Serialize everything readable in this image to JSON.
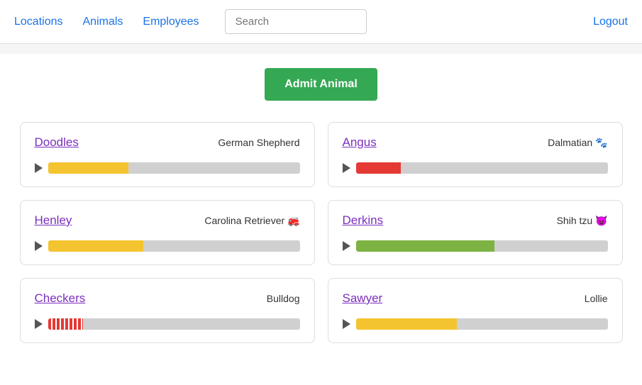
{
  "nav": {
    "links": [
      {
        "id": "locations",
        "label": "Locations"
      },
      {
        "id": "animals",
        "label": "Animals"
      },
      {
        "id": "employees",
        "label": "Employees"
      }
    ],
    "search_placeholder": "Search",
    "logout_label": "Logout"
  },
  "main": {
    "admit_label": "Admit Animal",
    "animals": [
      {
        "id": "doodles",
        "name": "Doodles",
        "breed": "German Shepherd",
        "emoji": "",
        "progress": 32,
        "bar_color": "yellow",
        "col": 0
      },
      {
        "id": "angus",
        "name": "Angus",
        "breed": "Dalmatian",
        "emoji": "🐾",
        "progress": 18,
        "bar_color": "red",
        "col": 1
      },
      {
        "id": "henley",
        "name": "Henley",
        "breed": "Carolina Retriever",
        "emoji": "🚒",
        "progress": 38,
        "bar_color": "yellow",
        "col": 0
      },
      {
        "id": "derkins",
        "name": "Derkins",
        "breed": "Shih tzu",
        "emoji": "😈",
        "progress": 55,
        "bar_color": "green",
        "col": 1
      },
      {
        "id": "checkers",
        "name": "Checkers",
        "breed": "Bulldog",
        "emoji": "",
        "progress": 14,
        "bar_color": "red-hatch",
        "col": 0
      },
      {
        "id": "sawyer",
        "name": "Sawyer",
        "breed": "Lollie",
        "emoji": "",
        "progress": 40,
        "bar_color": "yellow",
        "col": 1
      }
    ]
  }
}
